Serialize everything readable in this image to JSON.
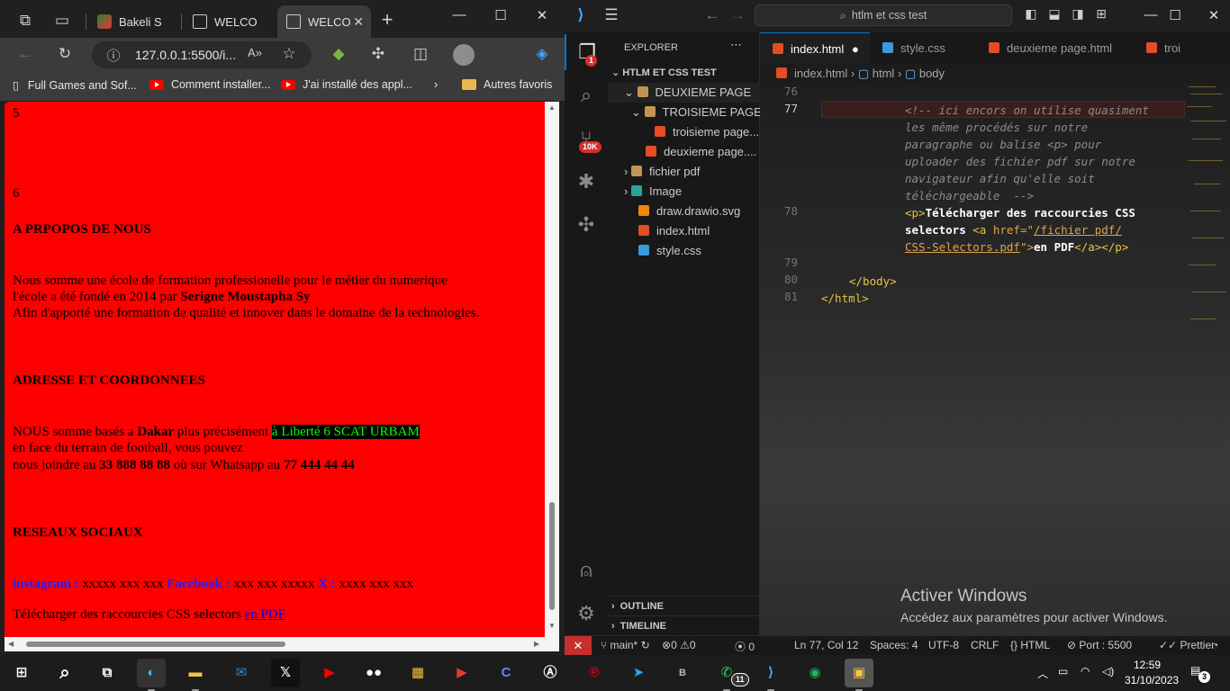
{
  "browser": {
    "tabs": [
      {
        "label": "Bakeli S"
      },
      {
        "label": "WELCO"
      },
      {
        "label": "WELCO"
      }
    ],
    "new_tab": "+",
    "address": "127.0.0.1:5500/i...",
    "favorites": [
      {
        "label": "Full Games and Sof..."
      },
      {
        "label": "Comment installer..."
      },
      {
        "label": "J'ai installé des appl..."
      },
      {
        "label": "Autres favoris"
      }
    ],
    "page": {
      "num5": "5",
      "num6": "6",
      "about_title": "A PRPOPOS DE NOUS",
      "about_line1": "Nous somme une école de formation professionelle pour le métier du numerique",
      "about_line2_prefix": "l'école a été fondé en 2014 par ",
      "about_line2_bold": "Serigne Moustapha Sy",
      "about_line3": "Afin d'apporté une formation de qualité et innover dans le domaine de la technologies.",
      "address_title": "ADRESSE ET COORDONNEES",
      "addr_prefix": "NOUS somme basés a ",
      "addr_city": "Dakar",
      "addr_mid": " plus précisément ",
      "addr_highlight": "à Liberté 6 SCAT URBAM",
      "addr_line2": "en face du terrain de football, vous pouvez",
      "addr_line3_prefix": "nous joindre au ",
      "addr_phone1": "33 888 88 88",
      "addr_line3_mid": " où sur Whatsapp au ",
      "addr_phone2": "77 444 44 44",
      "social_title": "RESEAUX SOCIAUX",
      "instagram_label": "instagram :",
      "instagram_value": " xxxxx xxx xxx ",
      "facebook_label": "Facebook :",
      "facebook_value": " xxx xxx xxxxx ",
      "x_label": "X :",
      "x_value": " xxxx xxx xxx",
      "download_text": "Télécharger des raccourcies CSS selectors ",
      "download_link": "en PDF"
    }
  },
  "vscode": {
    "search": "htlm et css test",
    "explorer_title": "EXPLORER",
    "workspace": "HTLM ET CSS TEST",
    "tree": [
      {
        "label": "DEUXIEME PAGE"
      },
      {
        "label": "TROISIEME PAGE"
      },
      {
        "label": "troisieme page..."
      },
      {
        "label": "deuxieme page...."
      },
      {
        "label": "fichier pdf"
      },
      {
        "label": "Image"
      },
      {
        "label": "draw.drawio.svg"
      },
      {
        "label": "index.html"
      },
      {
        "label": "style.css"
      }
    ],
    "outline": "OUTLINE",
    "timeline": "TIMELINE",
    "editor_tabs": [
      {
        "label": "index.html"
      },
      {
        "label": "style.css"
      },
      {
        "label": "deuxieme page.html"
      },
      {
        "label": "troi"
      }
    ],
    "breadcrumbs": {
      "file": "index.html",
      "html": "html",
      "body": "body",
      "sep": "›"
    },
    "line_numbers": [
      "76",
      "77",
      "78",
      "79",
      "80",
      "81"
    ],
    "code": {
      "c1": "<!-- ici encors on utilise quasiment",
      "c2": "les même procédés sur notre",
      "c3": "paragraphe ou balise <p> pour",
      "c4": "uploader des fichier pdf sur notre",
      "c5": "navigateur afin qu'elle soit",
      "c6": "téléchargeable  -->",
      "p_open": "<p>",
      "p_text": "Télécharger des raccourcies CSS",
      "p_text2": "selectors ",
      "a_open": "<a ",
      "a_attr": "href=",
      "a_q1": "\"",
      "a_val1": "/fichier pdf/",
      "a_val2": "CSS-Selectors.pdf",
      "a_q2": "\">",
      "a_text": "en PDF",
      "a_close": "</a></p>",
      "body_close": "</body>",
      "html_close": "</html>"
    },
    "activate_title": "Activer Windows",
    "activate_sub": "Accédez aux paramètres pour activer Windows.",
    "badges": {
      "explorer": "1",
      "scm": "10K"
    },
    "status": {
      "branch": "main*",
      "errors": "0",
      "warnings": "0",
      "ports_count": "0",
      "position": "Ln 77, Col 12",
      "spaces": "Spaces: 4",
      "encoding": "UTF-8",
      "eol": "CRLF",
      "language": "HTML",
      "port": "Port : 5500",
      "prettier": "Prettier"
    }
  },
  "taskbar": {
    "time": "12:59",
    "date": "31/10/2023",
    "notifications": "3",
    "whatsapp_badge": "11"
  },
  "colors": {
    "page_bg": "#ff0000",
    "vscode_accent": "#0078d4",
    "remote_red": "#c72e2e"
  }
}
